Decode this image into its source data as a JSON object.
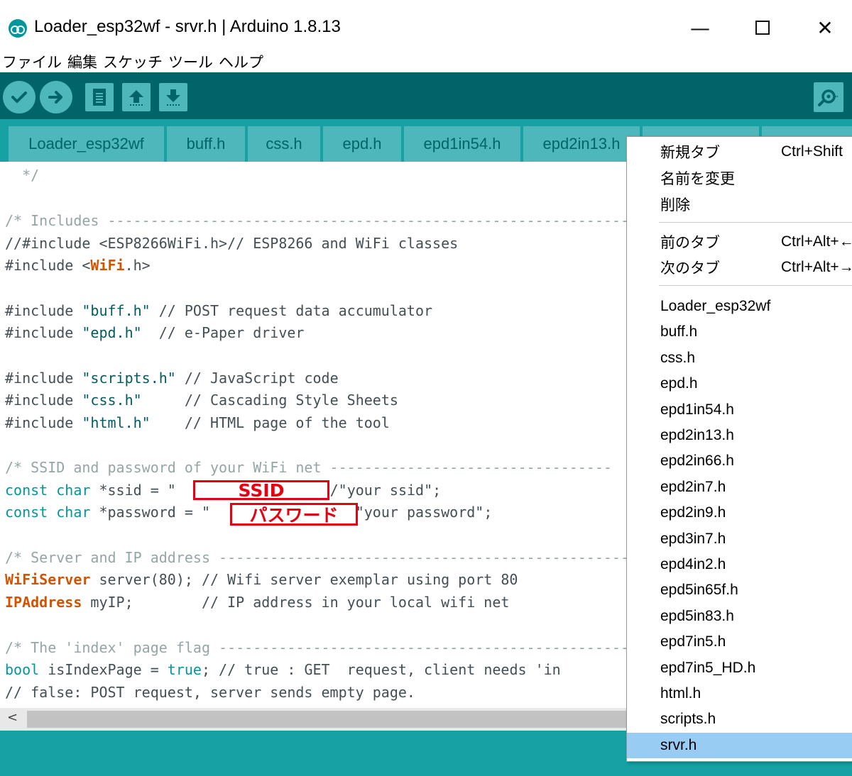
{
  "window": {
    "title": "Loader_esp32wf - srvr.h | Arduino 1.8.13",
    "minimize_glyph": "—",
    "close_glyph": "✕"
  },
  "menubar": [
    "ファイル",
    "編集",
    "スケッチ",
    "ツール",
    "ヘルプ"
  ],
  "toolbar": {
    "icons": [
      "check-icon",
      "arrow-right-icon",
      "new-file-icon",
      "arrow-up-icon",
      "arrow-down-icon",
      "magnifier-icon"
    ]
  },
  "tabs": [
    "Loader_esp32wf",
    "buff.h",
    "css.h",
    "epd.h",
    "epd1in54.h",
    "epd2in13.h"
  ],
  "code": {
    "l1": "  */",
    "l3": "/* Includes ---------------------------------------------------------------",
    "l4": "//#include <ESP8266WiFi.h>// ESP8266 and WiFi classes",
    "l5a": "#include <",
    "l5b": "WiFi",
    "l5c": ".h>",
    "l7a": "#include ",
    "l7b": "\"buff.h\"",
    "l7c": " // POST request data accumulator",
    "l8a": "#include ",
    "l8b": "\"epd.h\"",
    "l8c": "  // e-Paper driver",
    "l10a": "#include ",
    "l10b": "\"scripts.h\"",
    "l10c": " // JavaScript code",
    "l11a": "#include ",
    "l11b": "\"css.h\"",
    "l11c": "     // Cascading Style Sheets",
    "l12a": "#include ",
    "l12b": "\"html.h\"",
    "l12c": "    // HTML page of the tool",
    "l14": "/* SSID and password of your WiFi net ---------------------------------",
    "l15a": "const",
    "l15b": " char",
    "l15c": " *ssid = \"",
    "l15d": "           \";",
    "l15e": "    //\"your ssid\";",
    "l16a": "const",
    "l16b": " char",
    "l16c": " *password = \"",
    "l16d": "            \"; //\"your password\";",
    "l18": "/* Server and IP address -------------------------------------------------",
    "l19a": "WiFiServer",
    "l19b": " server(80); // Wifi server exemplar using port 80",
    "l20a": "IPAddress",
    "l20b": " myIP;        // IP address in your local wifi net",
    "l22": "/* The 'index' page flag -------------------------------------------------",
    "l23a": "bool",
    "l23b": " isIndexPage = ",
    "l23c": "true",
    "l23d": "; // true : GET  request, client needs 'in",
    "l24": "// false: POST request, server sends empty page."
  },
  "annotations": {
    "ssid": "SSID",
    "password": "パスワード"
  },
  "scrollbar": {
    "left_arrow": "<"
  },
  "popup": {
    "actions": [
      {
        "label": "新規タブ",
        "shortcut": "Ctrl+Shift"
      },
      {
        "label": "名前を変更",
        "shortcut": ""
      },
      {
        "label": "削除",
        "shortcut": ""
      }
    ],
    "nav": [
      {
        "label": "前のタブ",
        "shortcut": "Ctrl+Alt+←"
      },
      {
        "label": "次のタブ",
        "shortcut": "Ctrl+Alt+→"
      }
    ],
    "files": [
      "Loader_esp32wf",
      "buff.h",
      "css.h",
      "epd.h",
      "epd1in54.h",
      "epd2in13.h",
      "epd2in66.h",
      "epd2in7.h",
      "epd2in9.h",
      "epd3in7.h",
      "epd4in2.h",
      "epd5in65f.h",
      "epd5in83.h",
      "epd7in5.h",
      "epd7in5_HD.h",
      "html.h",
      "scripts.h",
      "srvr.h"
    ],
    "selected": "srvr.h"
  }
}
